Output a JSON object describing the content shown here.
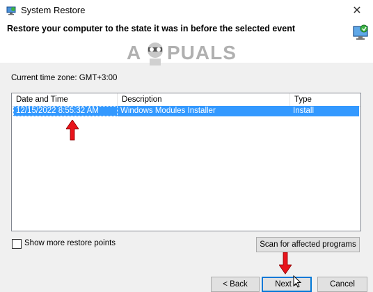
{
  "window": {
    "title": "System Restore",
    "close_glyph": "✕"
  },
  "header": {
    "heading": "Restore your computer to the state it was in before the selected event"
  },
  "watermark": {
    "text_left": "A",
    "text_right": "PUALS"
  },
  "timezone_label": "Current time zone: GMT+3:00",
  "restore_points": {
    "columns": [
      "Date and Time",
      "Description",
      "Type"
    ],
    "rows": [
      {
        "date": "12/15/2022 8:55:32 AM",
        "description": "Windows Modules Installer",
        "type": "Install"
      }
    ]
  },
  "options": {
    "show_more_label": "Show more restore points"
  },
  "buttons": {
    "scan": "Scan for affected programs",
    "back": "< Back",
    "next": "Next >",
    "cancel": "Cancel"
  },
  "colors": {
    "selection": "#3399ff",
    "annotation_arrow": "#e8141b"
  },
  "icons": {
    "app": "system-restore-icon",
    "header": "system-restore-monitor-icon"
  }
}
